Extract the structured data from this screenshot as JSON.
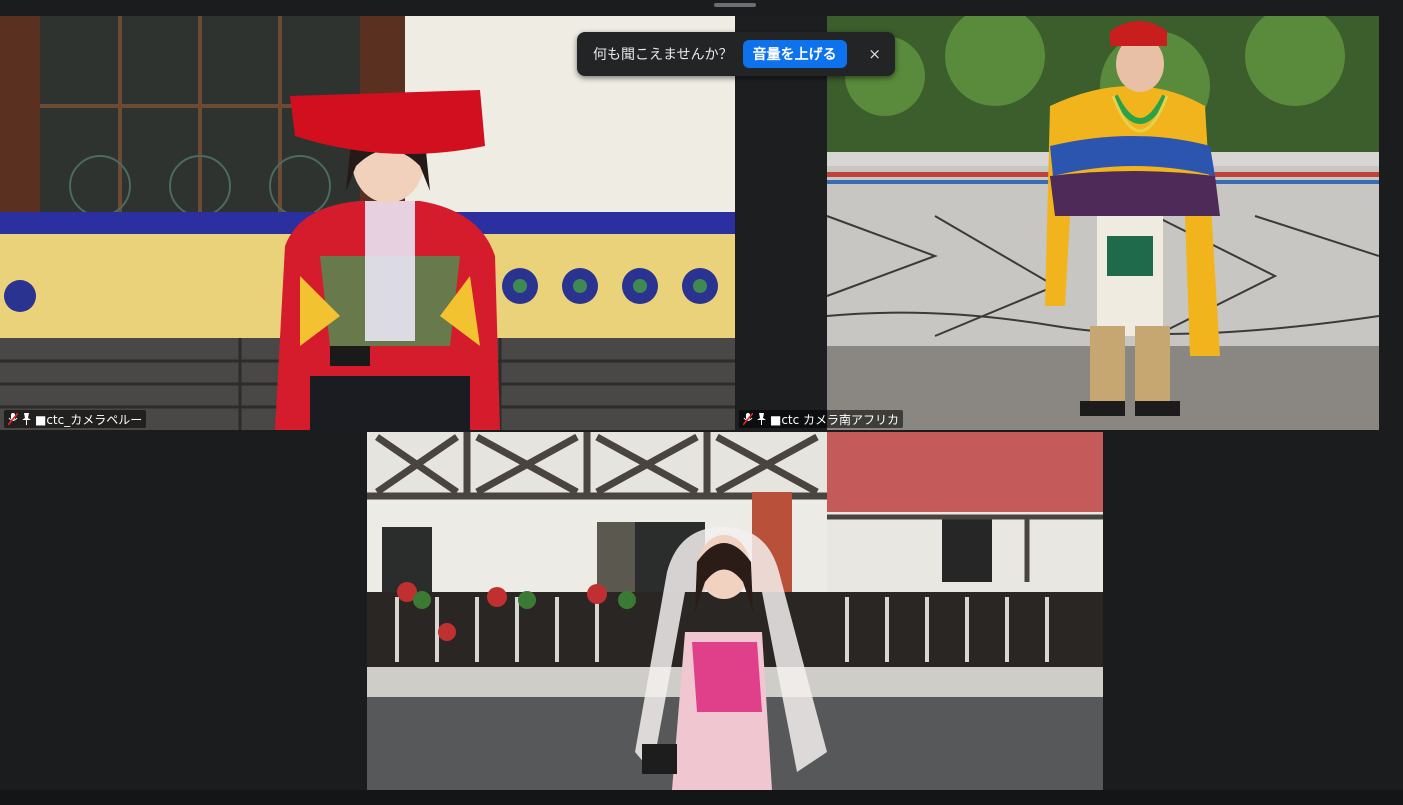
{
  "notice": {
    "message": "何も聞こえませんか？",
    "button_label": "音量を上げる",
    "close_glyph": "×"
  },
  "participants": [
    {
      "name": "■ctc_カメラペルー",
      "muted": true,
      "pinned": true
    },
    {
      "name": "■ctc カメラ南アフリカ",
      "muted": true,
      "pinned": true
    },
    {
      "name": "",
      "muted": false,
      "pinned": false
    }
  ],
  "colors": {
    "accent": "#0e72ed",
    "background": "#1a1c1e",
    "muted_icon": "#e02828"
  }
}
